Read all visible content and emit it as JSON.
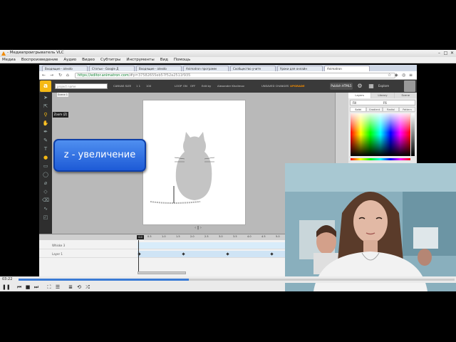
{
  "vlc": {
    "title": "- Медиапроигрыватель VLC",
    "menu": [
      "Медиа",
      "Воспроизведение",
      "Аудио",
      "Видео",
      "Субтитры",
      "Инструменты",
      "Вид",
      "Помощь"
    ],
    "time_current": "03:22",
    "progress": 0.39,
    "icons": {
      "play": "▶",
      "pause": "❚❚",
      "stop": "■",
      "prev": "⏮",
      "next": "⏭"
    }
  },
  "browser": {
    "tabs": [
      "Входящие - alexdo",
      "Статьи - Google Д",
      "Входящие - alexdo",
      "Animatron программ",
      "Сообщество учите",
      "Уроки для онлайн",
      "Animatron"
    ],
    "active_tab": 6,
    "url_scheme": "https://",
    "url_host": "editor.animatron.com",
    "url_rest": "/#p=37582655eb57f52a2511f935"
  },
  "app": {
    "logo": "a",
    "project_name_placeholder": "project name",
    "top_items": [
      "CANVAS SIZE",
      "1  1",
      "100",
      "LOOP",
      "ON",
      "OFF",
      "Edit by",
      "Alexander Khalimov",
      "UNSAVED CHANGES",
      "UPGRADE"
    ],
    "publish_label": "Publish HTML5",
    "user_name": "Explore",
    "tab_label": "Scene 1",
    "tooltip": "Zoom (Z)",
    "canvas_controls": "‹  ‖  ›",
    "right_panel": {
      "tabs": [
        "Layers",
        "Library",
        "Scene"
      ],
      "fill_label": "Fill",
      "fill_value": "F6",
      "modes": [
        "Solid",
        "Gradient",
        "Radial",
        "Pattern"
      ]
    }
  },
  "overlay": {
    "zoom_label": "z - увеличение"
  },
  "timeline": {
    "ruler": [
      "0.0",
      "0.5",
      "1.0",
      "1.5",
      "2.0",
      "2.5",
      "3.0",
      "3.5",
      "4.0",
      "4.5",
      "5.0"
    ],
    "playhead": "0.0",
    "layers": [
      {
        "name": "Whiske 3",
        "selected": true
      },
      {
        "name": "Layer 1",
        "selected": false
      }
    ],
    "keyframes": [
      0.0,
      1.5,
      3.0,
      4.5
    ]
  },
  "colors": {
    "accent": "#f5b914",
    "overlay_blue": "#2d6de3"
  }
}
